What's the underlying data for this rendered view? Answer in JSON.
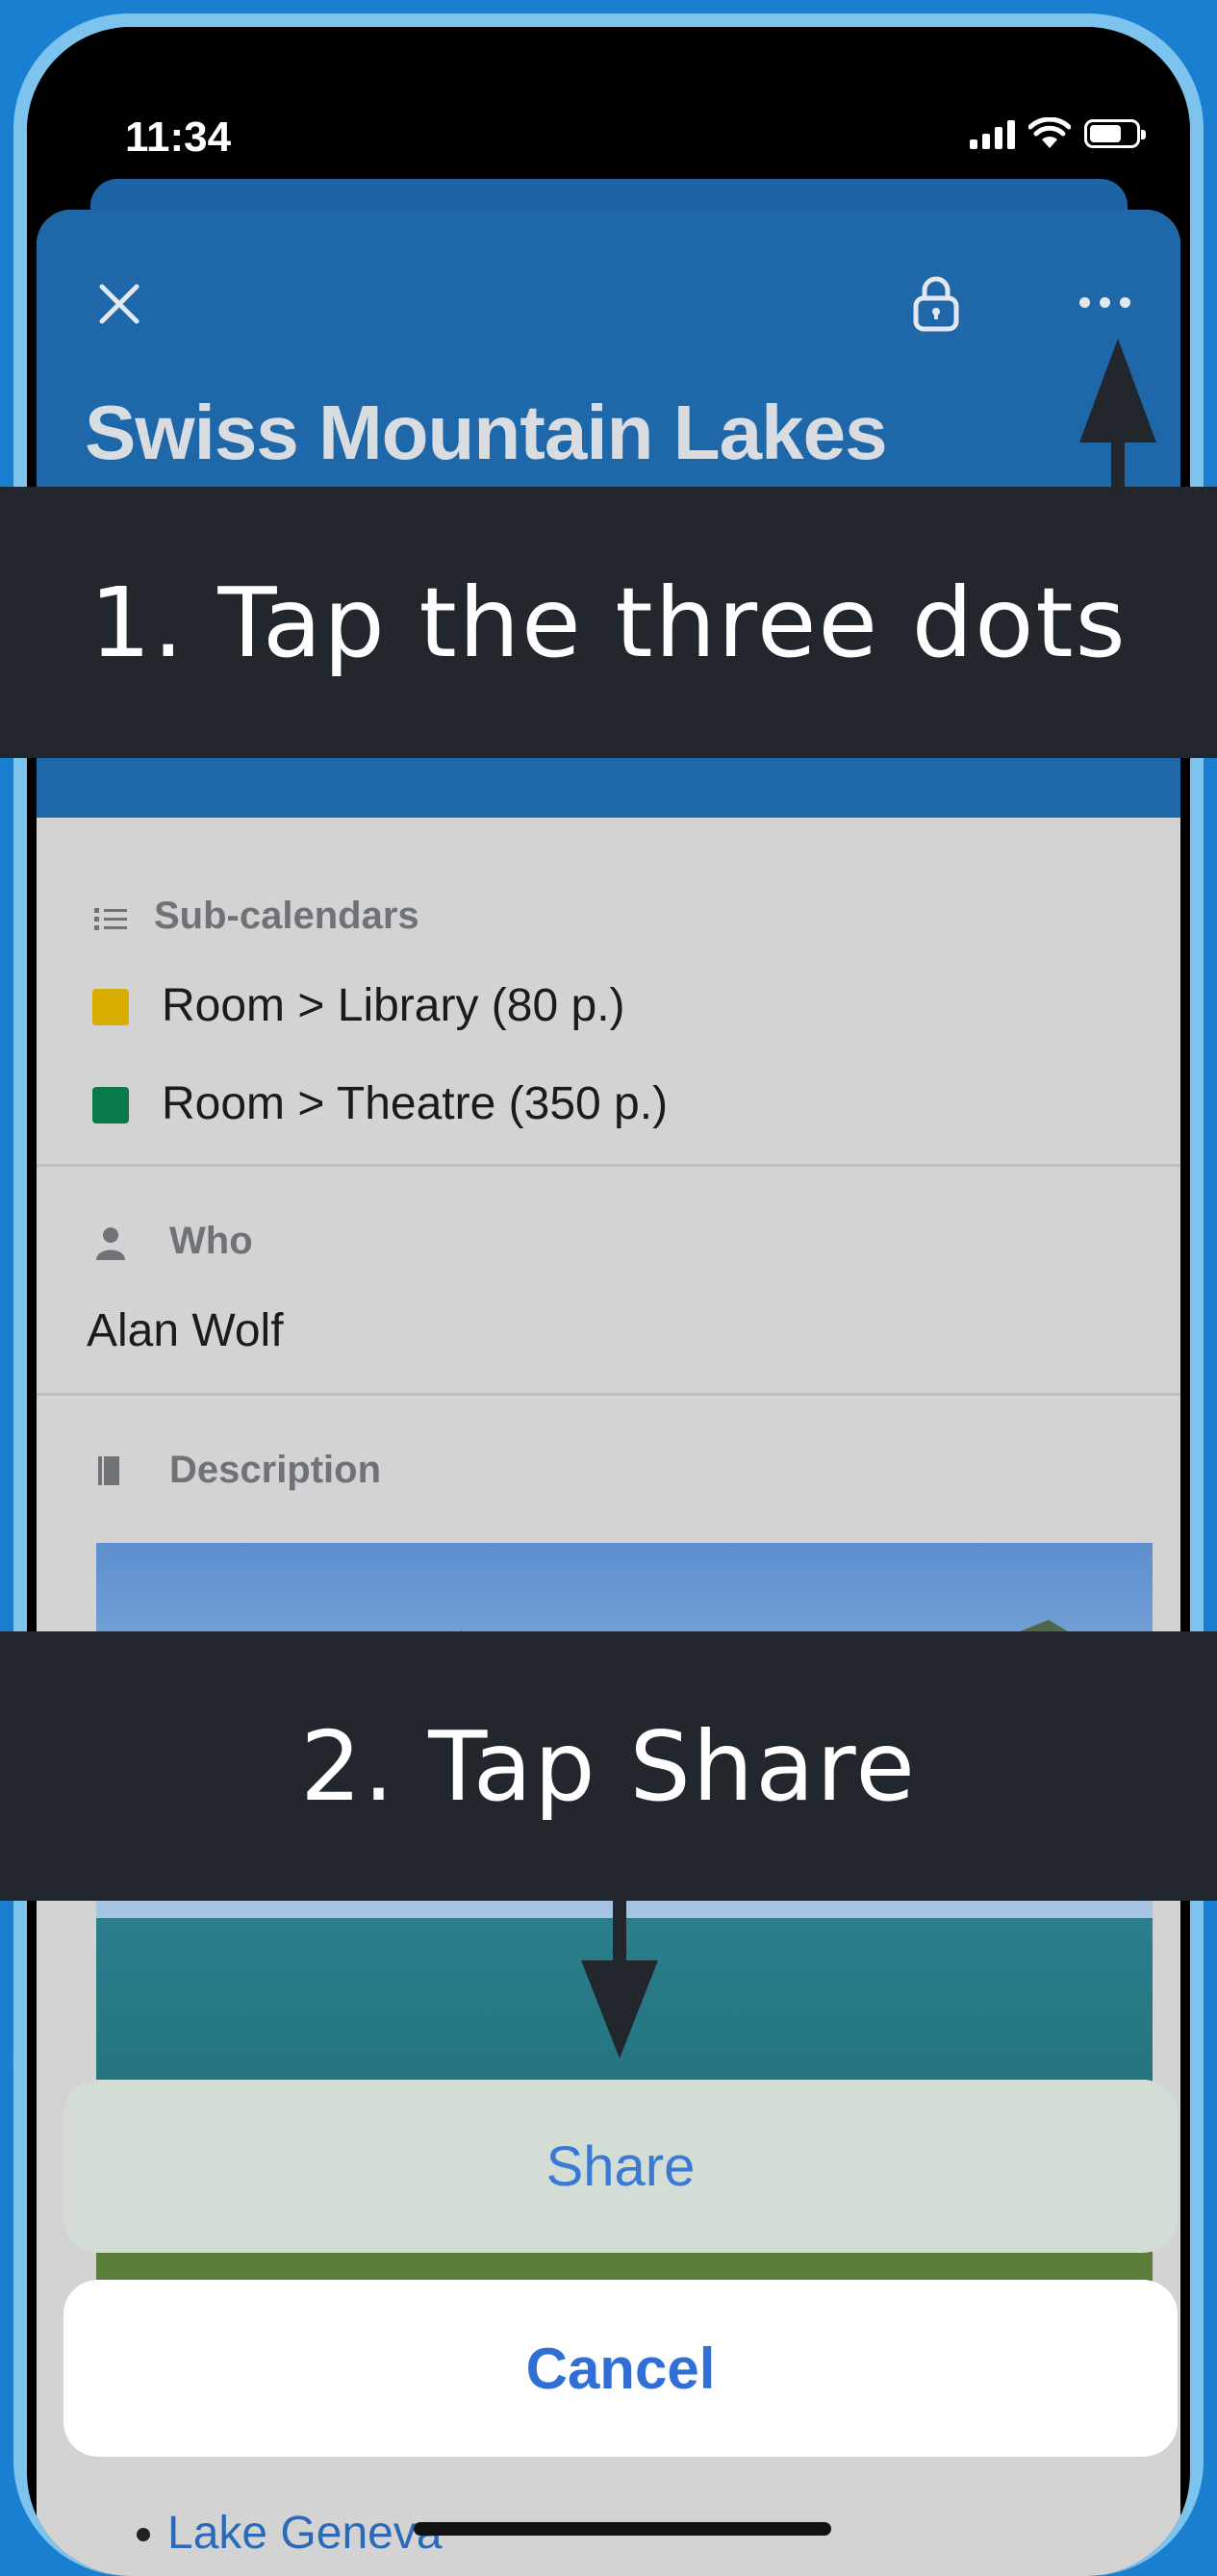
{
  "status_bar": {
    "time": "11:34"
  },
  "event": {
    "title": "Swiss Mountain Lakes",
    "sub_calendars_label": "Sub-calendars",
    "sub_calendars": [
      {
        "label": "Room > Library (80 p.)",
        "color": "#d9ad00"
      },
      {
        "label": "Room > Theatre (350 p.)",
        "color": "#0a7a4c"
      }
    ],
    "who_label": "Who",
    "who_value": "Alan Wolf",
    "description_label": "Description",
    "list_items": [
      "Lake Geneva"
    ]
  },
  "instructions": {
    "step1": "1.  Tap the three dots",
    "step2": "2. Tap Share"
  },
  "action_sheet": {
    "share_label": "Share",
    "cancel_label": "Cancel"
  },
  "colors": {
    "header_blue": "#1e68a9",
    "band_dark": "#22272d",
    "link_blue": "#3a7ad4"
  }
}
